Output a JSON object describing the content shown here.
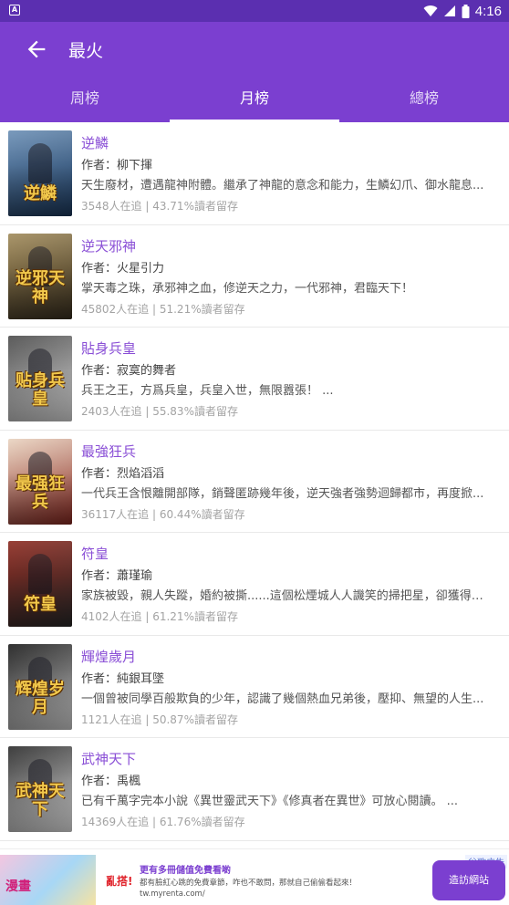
{
  "status_bar": {
    "notification_badge": "A",
    "icons": [
      "wifi-icon",
      "signal-icon",
      "battery-icon"
    ],
    "time": "4:16"
  },
  "app_bar": {
    "title": "最火",
    "back_icon": "back-arrow-icon"
  },
  "tabs": [
    {
      "label": "周榜",
      "active": false
    },
    {
      "label": "月榜",
      "active": true
    },
    {
      "label": "總榜",
      "active": false
    }
  ],
  "books": [
    {
      "title": "逆鱗",
      "author": "作者：柳下揮",
      "desc": "天生廢材，遭遇龍神附體。繼承了神龍的意念和能力，生鱗幻爪、御水龍息...",
      "stats": "3548人在追 | 43.71%讀者留存",
      "cover_text": "逆鱗",
      "cover_colors": [
        "#1d3a5e",
        "#6b8fb5"
      ]
    },
    {
      "title": "逆天邪神",
      "author": "作者：火星引力",
      "desc": "掌天毒之珠，承邪神之血，修逆天之力，一代邪神，君臨天下！",
      "stats": "45802人在追 | 51.21%讀者留存",
      "cover_text": "逆邪天神",
      "cover_colors": [
        "#3a3020",
        "#a08a5a"
      ]
    },
    {
      "title": "貼身兵皇",
      "author": "作者：寂寞的舞者",
      "desc": "兵王之王，方爲兵皇，兵皇入世，無限囂張！ ...",
      "stats": "2403人在追 | 55.83%讀者留存",
      "cover_text": "贴身兵皇",
      "cover_colors": [
        "#e6e6e6",
        "#4a4a4a"
      ]
    },
    {
      "title": "最強狂兵",
      "author": "作者：烈焰滔滔",
      "desc": "一代兵王含恨離開部隊，銷聲匿跡幾年後，逆天強者強勢迴歸都市，再度掀...",
      "stats": "36117人在追 | 60.44%讀者留存",
      "cover_text": "最强狂兵",
      "cover_colors": [
        "#8a2a22",
        "#e9d3c0"
      ]
    },
    {
      "title": "符皇",
      "author": "作者：蕭瑾瑜",
      "desc": "家族被毀，親人失蹤，婚約被撕......這個松煙城人人譏笑的掃把星，卻獲得百...",
      "stats": "4102人在追 | 61.21%讀者留存",
      "cover_text": "符皇",
      "cover_colors": [
        "#2a2a2a",
        "#8c2a20"
      ]
    },
    {
      "title": "輝煌歲月",
      "author": "作者：純銀耳墜",
      "desc": "一個曾被同學百般欺負的少年，認識了幾個熱血兄弟後，壓抑、無望的人生...",
      "stats": "1121人在追 | 50.87%讀者留存",
      "cover_text": "辉煌岁月",
      "cover_colors": [
        "#d9d9d9",
        "#1a1a1a"
      ]
    },
    {
      "title": "武神天下",
      "author": "作者：禹楓",
      "desc": "已有千萬字完本小說《異世靈武天下》《修真者在異世》可放心閱讀。 ...",
      "stats": "14369人在追 | 61.76%讀者留存",
      "cover_text": "武神天下",
      "cover_colors": [
        "#efefef",
        "#2a2a2a"
      ]
    }
  ],
  "ad": {
    "image_text": "漫畫",
    "brand": "亂搭!",
    "headline": "更有多冊儲值免費看喲",
    "sub": "都有臉紅心跳的免費章節，咋也不敢問，那就自己偷偷看起來！",
    "url": "tw.myrenta.com/",
    "label": "谷歌广告",
    "visit_button": "造訪網站"
  }
}
